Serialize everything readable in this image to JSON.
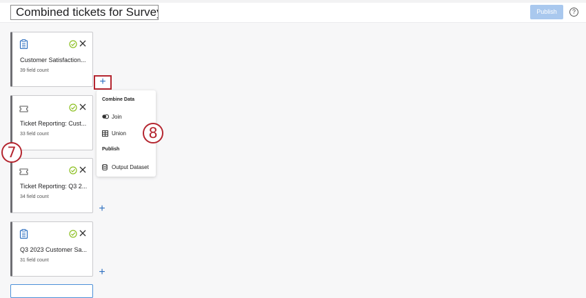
{
  "header": {
    "title": "Combined tickets for Survey...",
    "publish_label": "Publish",
    "help_label": "?"
  },
  "cards": [
    {
      "name": "Customer Satisfaction...",
      "count": "39 field count",
      "icon": "survey-clipboard-icon"
    },
    {
      "name": "Ticket Reporting: Cust...",
      "count": "33 field count",
      "icon": "ticket-icon"
    },
    {
      "name": "Ticket Reporting: Q3 2...",
      "count": "34 field count",
      "icon": "ticket-icon"
    },
    {
      "name": "Q3 2023 Customer Sa...",
      "count": "31 field count",
      "icon": "survey-clipboard-icon"
    }
  ],
  "menu": {
    "combine_header": "Combine Data",
    "join_label": "Join",
    "union_label": "Union",
    "publish_header": "Publish",
    "output_label": "Output Dataset"
  },
  "callouts": {
    "left": "7",
    "right": "8"
  },
  "colors": {
    "accent": "#2d6fc0",
    "callout": "#b4252f",
    "success": "#8bbf1f",
    "publish_disabled": "#a9c8ee"
  }
}
